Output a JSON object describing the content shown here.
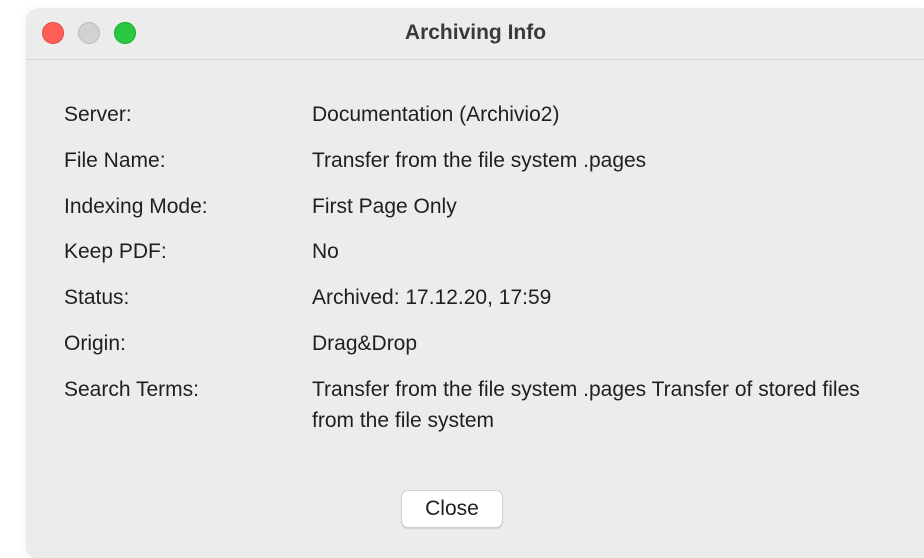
{
  "window": {
    "title": "Archiving Info"
  },
  "fields": [
    {
      "label": "Server:",
      "value": "Documentation (Archivio2)"
    },
    {
      "label": "File Name:",
      "value": "Transfer from the file system .pages"
    },
    {
      "label": "Indexing Mode:",
      "value": "First Page Only"
    },
    {
      "label": "Keep PDF:",
      "value": "No"
    },
    {
      "label": "Status:",
      "value": "Archived: 17.12.20, 17:59"
    },
    {
      "label": "Origin:",
      "value": "Drag&Drop"
    },
    {
      "label": "Search Terms:",
      "value": "Transfer from the file system .pages Transfer of stored files from the file system"
    }
  ],
  "buttons": {
    "close_label": "Close"
  },
  "colors": {
    "window_bg": "#ececec",
    "traffic_close": "#ff5f57",
    "traffic_minimize": "#d2d2d2",
    "traffic_zoom": "#28c840"
  }
}
